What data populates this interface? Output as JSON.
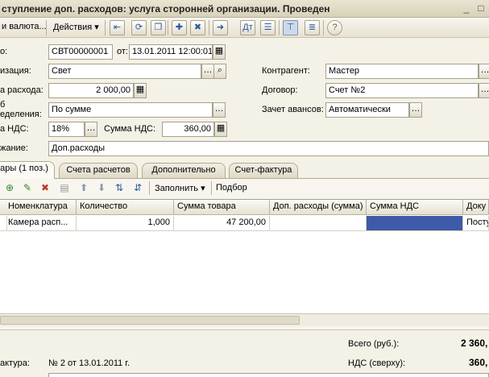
{
  "window": {
    "title": "ступление доп. расходов: услуга сторонней организации. Проведен",
    "minimize": "_",
    "maximize": "□"
  },
  "toolbar": {
    "currency_label": "и валюта...",
    "actions_label": "Действия",
    "actions_arrow": "▾"
  },
  "form": {
    "number_label": "о:",
    "number_value": "СВТ00000001",
    "date_label": "от:",
    "date_value": "13.01.2011 12:00:01",
    "org_label": "изация:",
    "org_value": "Свет",
    "counterparty_label": "Контрагент:",
    "counterparty_value": "Мастер",
    "expense_sum_label": "а расхода:",
    "expense_sum_value": "2 000,00",
    "contract_label": "Договор:",
    "contract_value": "Счет №2",
    "distribution_label_1": "б",
    "distribution_label_2": "еделения:",
    "distribution_value": "По сумме",
    "advance_label": "Зачет авансов:",
    "advance_value": "Автоматически",
    "vat_rate_label": "а НДС:",
    "vat_rate_value": "18%",
    "vat_sum_label": "Сумма НДС:",
    "vat_sum_value": "360,00",
    "content_label": "жание:",
    "content_value": "Доп.расходы"
  },
  "tabs": [
    {
      "label": "ары (1 поз.)"
    },
    {
      "label": "Счета расчетов"
    },
    {
      "label": "Дополнительно"
    },
    {
      "label": "Счет-фактура"
    }
  ],
  "subtoolbar": {
    "fill_label": "Заполнить",
    "fill_arrow": "▾",
    "select_label": "Подбор"
  },
  "grid": {
    "columns": [
      "Номенклатура",
      "Количество",
      "Сумма товара",
      "Доп. расходы (сумма)",
      "Сумма НДС",
      "Доку"
    ],
    "rows": [
      {
        "nomenclature": "Камера расп...",
        "quantity": "1,000",
        "goods_sum": "47 200,00",
        "extra_sum": "",
        "vat_sum": "",
        "doc": "Посту"
      }
    ]
  },
  "footer": {
    "invoice_label": "актура:",
    "invoice_value": "№ 2 от 13.01.2011 г.",
    "total_label": "Всего (руб.):",
    "total_value": "2 360,",
    "vat_label": "НДС (сверху):",
    "vat_value": "360,"
  },
  "colors": {
    "selected_cell": "#3f5aa8",
    "window_bg": "#f4f1e6"
  }
}
